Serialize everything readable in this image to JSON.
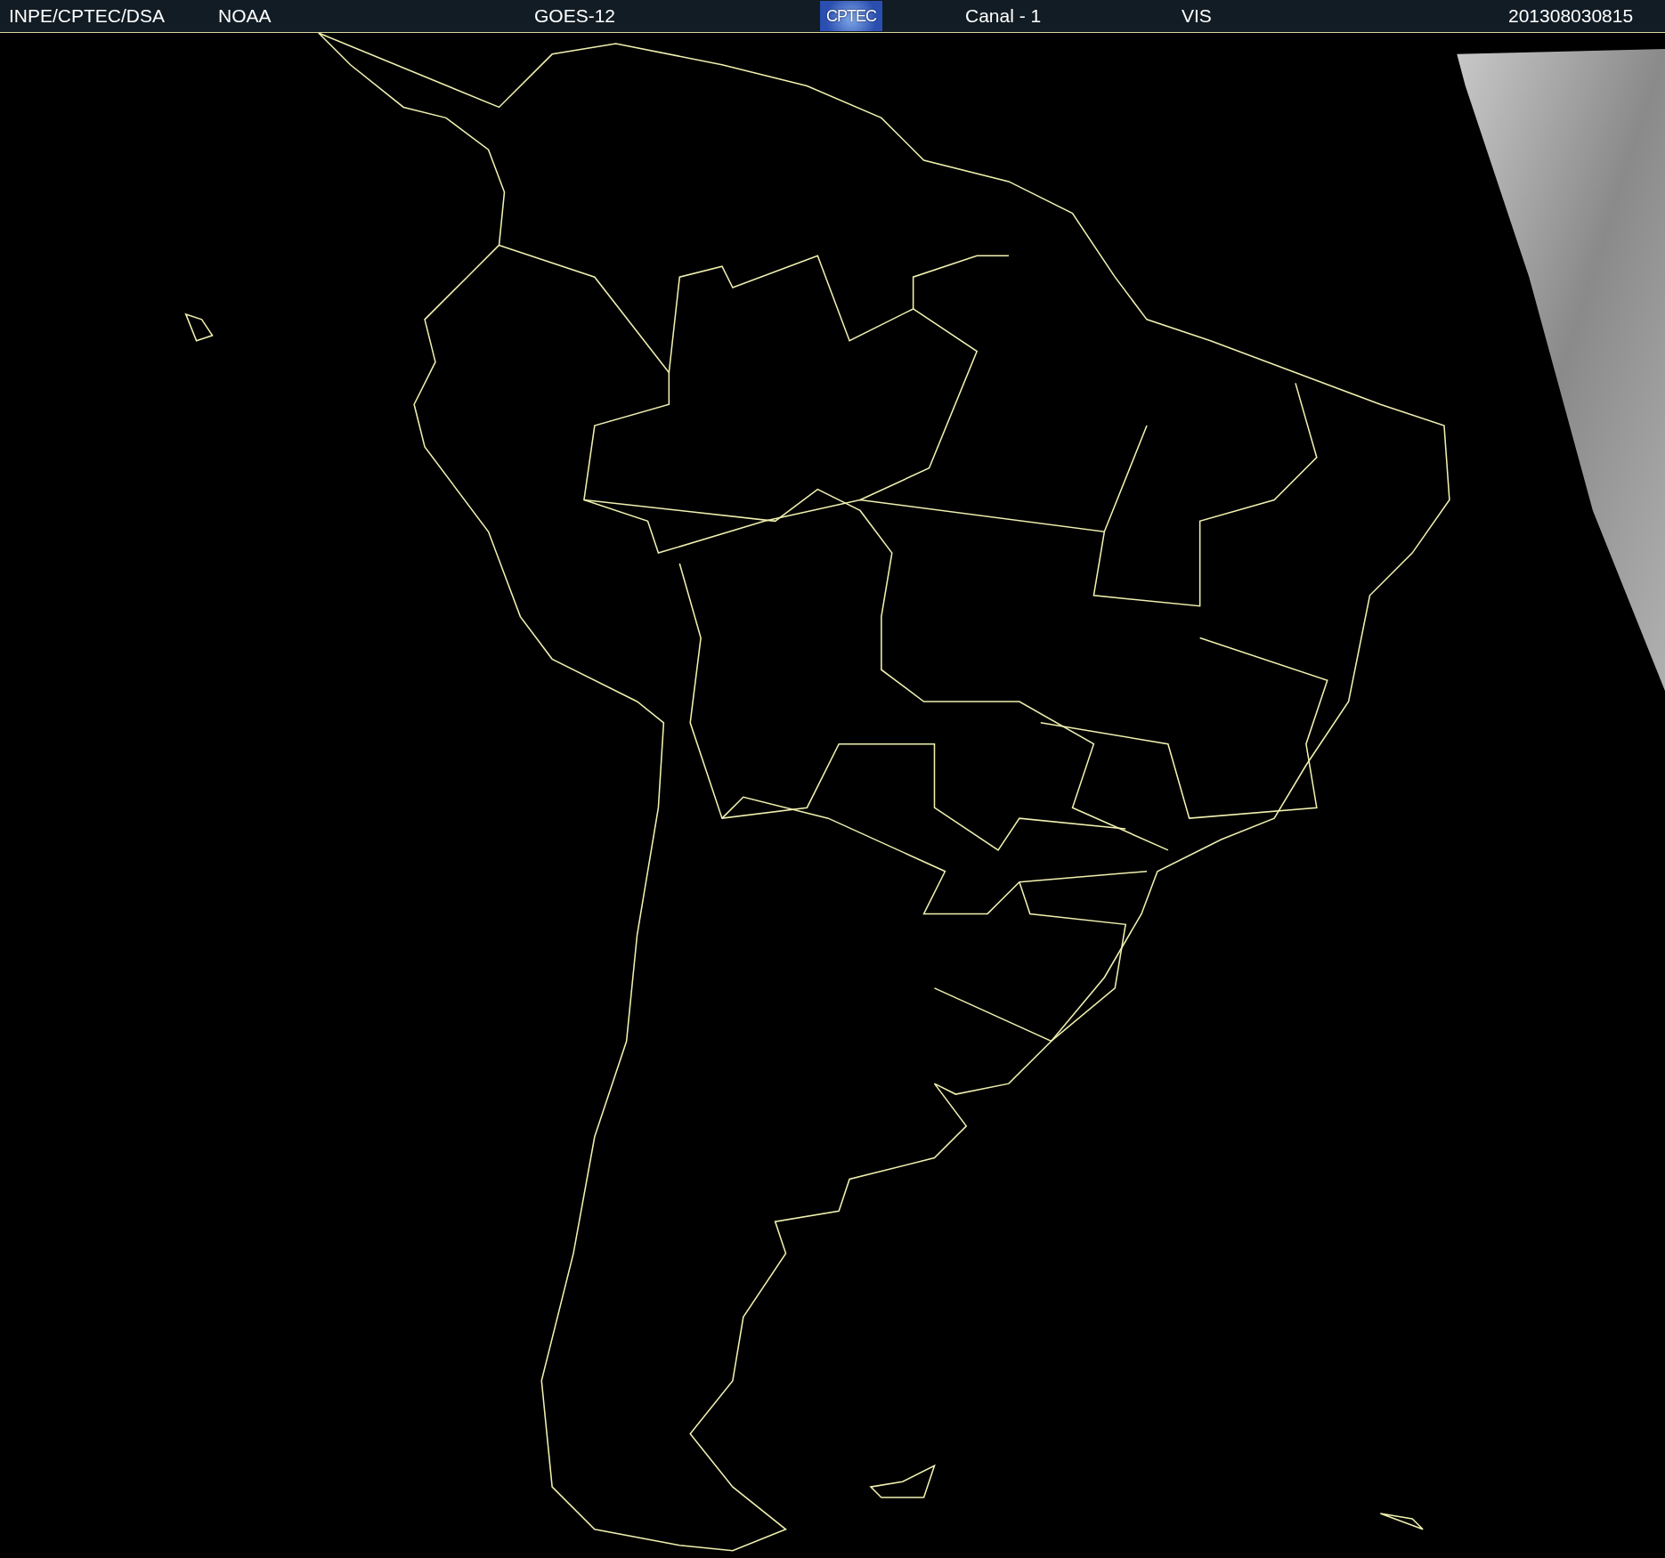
{
  "header": {
    "source": "INPE/CPTEC/DSA",
    "agency": "NOAA",
    "satellite": "GOES-12",
    "logo": "CPTEC",
    "channel": "Canal - 1",
    "band": "VIS",
    "timestamp": "201308030815"
  }
}
